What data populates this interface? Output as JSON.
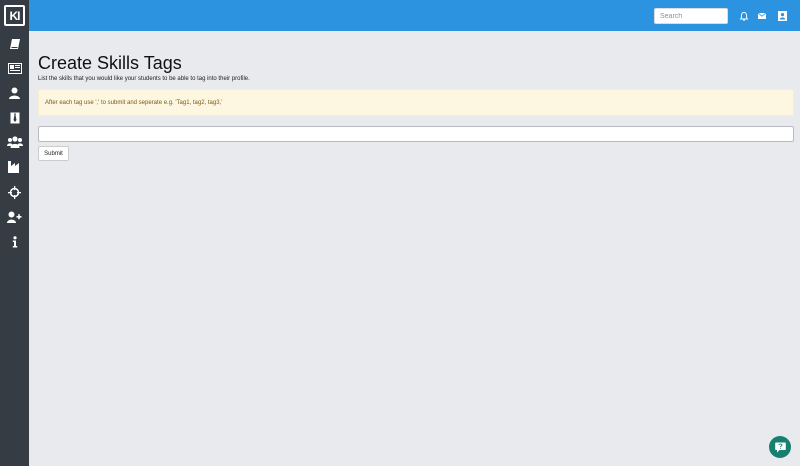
{
  "sidebar": {
    "logo": "KI",
    "items": [
      {
        "icon": "book-icon"
      },
      {
        "icon": "newspaper-icon"
      },
      {
        "icon": "user-icon"
      },
      {
        "icon": "tie-icon"
      },
      {
        "icon": "users-icon"
      },
      {
        "icon": "industry-icon"
      },
      {
        "icon": "crosshairs-icon"
      },
      {
        "icon": "user-plus-icon"
      },
      {
        "icon": "info-icon"
      }
    ]
  },
  "header": {
    "search_placeholder": "Search",
    "icons": [
      "bell-icon",
      "envelope-icon",
      "profile-card-icon"
    ],
    "color": "#2b93e0"
  },
  "main": {
    "title": "Create Skills Tags",
    "subtitle": "List the skills that you would like your students to be able to tag into their profile.",
    "alert_text": "After each tag use ',' to submit and seperate e.g. 'Tag1, tag2, tag3,'",
    "input_value": "",
    "submit_label": "Submit"
  },
  "help_button": {
    "icon": "help-chat-icon",
    "color": "#177e72"
  }
}
